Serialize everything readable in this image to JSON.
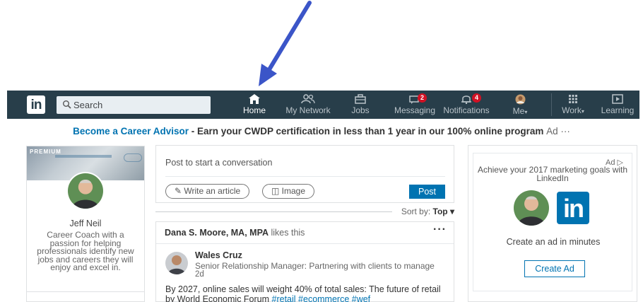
{
  "nav": {
    "logo": "in",
    "search_placeholder": "Search",
    "items": [
      {
        "label": "Home",
        "icon": "home-icon",
        "badge": ""
      },
      {
        "label": "My Network",
        "icon": "people-icon",
        "badge": ""
      },
      {
        "label": "Jobs",
        "icon": "briefcase-icon",
        "badge": ""
      },
      {
        "label": "Messaging",
        "icon": "chat-icon",
        "badge": "2"
      },
      {
        "label": "Notifications",
        "icon": "bell-icon",
        "badge": "4"
      },
      {
        "label": "Me",
        "icon": "avatar-icon",
        "badge": ""
      },
      {
        "label": "Work",
        "icon": "grid-icon",
        "badge": ""
      },
      {
        "label": "Learning",
        "icon": "play-icon",
        "badge": ""
      }
    ]
  },
  "banner": {
    "link": "Become a Career Advisor",
    "text": " - Earn your CWDP certification in less than 1 year in our 100% online program",
    "ad": "Ad ···"
  },
  "profile": {
    "premium": "PREMIUM",
    "name": "Jeff Neil",
    "headline": "Career Coach with a passion for helping professionals identify new jobs and careers they will enjoy and excel in."
  },
  "share": {
    "prompt": "Post to start a conversation",
    "write_article": "✎ Write an article",
    "image": "◫ Image",
    "post": "Post"
  },
  "sort": {
    "label": "Sort by: ",
    "value": "Top ▾"
  },
  "feed": {
    "liker_name": "Dana S. Moore, MA, MPA",
    "liker_action": " likes this",
    "more": "···",
    "actor_name": "Wales Cruz",
    "actor_headline": "Senior Relationship Manager: Partnering with clients to manage",
    "time": "2d",
    "text": "By 2027, online sales will weight 40% of total sales: The future of retail by World Economic Forum ",
    "hashtags": "#retail #ecommerce #wef"
  },
  "ad": {
    "label": "Ad ▷",
    "headline": "Achieve your 2017 marketing goals with LinkedIn",
    "logo": "in",
    "sub": "Create an ad in minutes",
    "cta": "Create Ad"
  },
  "colors": {
    "nav_bg": "#283e4a",
    "brand": "#0073b1",
    "badge": "#d11124",
    "arrow": "#3b55c8"
  }
}
